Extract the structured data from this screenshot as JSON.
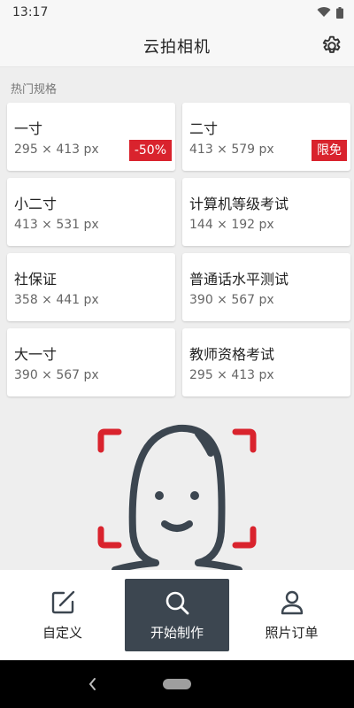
{
  "status": {
    "time": "13:17"
  },
  "app": {
    "title": "云拍相机"
  },
  "section": {
    "hot_title": "热门规格"
  },
  "cards": [
    {
      "name": "一寸",
      "size": "295 × 413 px",
      "badge": "-50%"
    },
    {
      "name": "二寸",
      "size": "413 × 579 px",
      "badge": "限免"
    },
    {
      "name": "小二寸",
      "size": "413 × 531 px"
    },
    {
      "name": "计算机等级考试",
      "size": "144 × 192 px"
    },
    {
      "name": "社保证",
      "size": "358 × 441 px"
    },
    {
      "name": "普通话水平测试",
      "size": "390 × 567 px"
    },
    {
      "name": "大一寸",
      "size": "390 × 567 px"
    },
    {
      "name": "教师资格考试",
      "size": "295 × 413 px"
    }
  ],
  "bottom_nav": {
    "custom_label": "自定义",
    "start_label": "开始制作",
    "orders_label": "照片订单"
  },
  "colors": {
    "accent_red": "#d9232d",
    "dark": "#3c4650",
    "background": "#eeeeee"
  },
  "icons": {
    "settings": "gear-icon",
    "custom": "edit-icon",
    "start": "search-icon",
    "orders": "person-icon"
  }
}
